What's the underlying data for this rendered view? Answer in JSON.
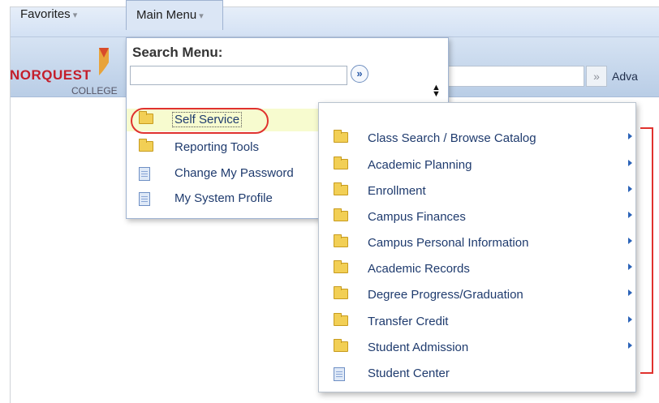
{
  "nav": {
    "favorites_label": "Favorites",
    "main_menu_label": "Main Menu"
  },
  "header": {
    "logo_text": "NORQUEST",
    "logo_sub": "COLLEGE",
    "search_go_glyph": "»",
    "advanced_link": "Adva"
  },
  "menu": {
    "search_label": "Search Menu:",
    "search_value": "",
    "go_glyph": "»",
    "items": [
      {
        "label": "Self Service",
        "icon": "folder-icon"
      },
      {
        "label": "Reporting Tools",
        "icon": "folder-icon"
      },
      {
        "label": "Change My Password",
        "icon": "page-icon"
      },
      {
        "label": "My System Profile",
        "icon": "page-icon"
      }
    ]
  },
  "submenu": {
    "items": [
      {
        "label": "Class Search / Browse Catalog",
        "icon": "folder-icon",
        "has_arrow": true
      },
      {
        "label": "Academic Planning",
        "icon": "folder-icon",
        "has_arrow": true
      },
      {
        "label": "Enrollment",
        "icon": "folder-icon",
        "has_arrow": true
      },
      {
        "label": "Campus Finances",
        "icon": "folder-icon",
        "has_arrow": true
      },
      {
        "label": "Campus Personal Information",
        "icon": "folder-icon",
        "has_arrow": true
      },
      {
        "label": "Academic Records",
        "icon": "folder-icon",
        "has_arrow": true
      },
      {
        "label": "Degree Progress/Graduation",
        "icon": "folder-icon",
        "has_arrow": true
      },
      {
        "label": "Transfer Credit",
        "icon": "folder-icon",
        "has_arrow": true
      },
      {
        "label": "Student Admission",
        "icon": "folder-icon",
        "has_arrow": true
      },
      {
        "label": "Student Center",
        "icon": "page-icon",
        "has_arrow": false
      }
    ]
  },
  "colors": {
    "annotation_red": "#e0322e",
    "link_blue": "#1f3b6e",
    "highlight": "#f7fbcf"
  }
}
